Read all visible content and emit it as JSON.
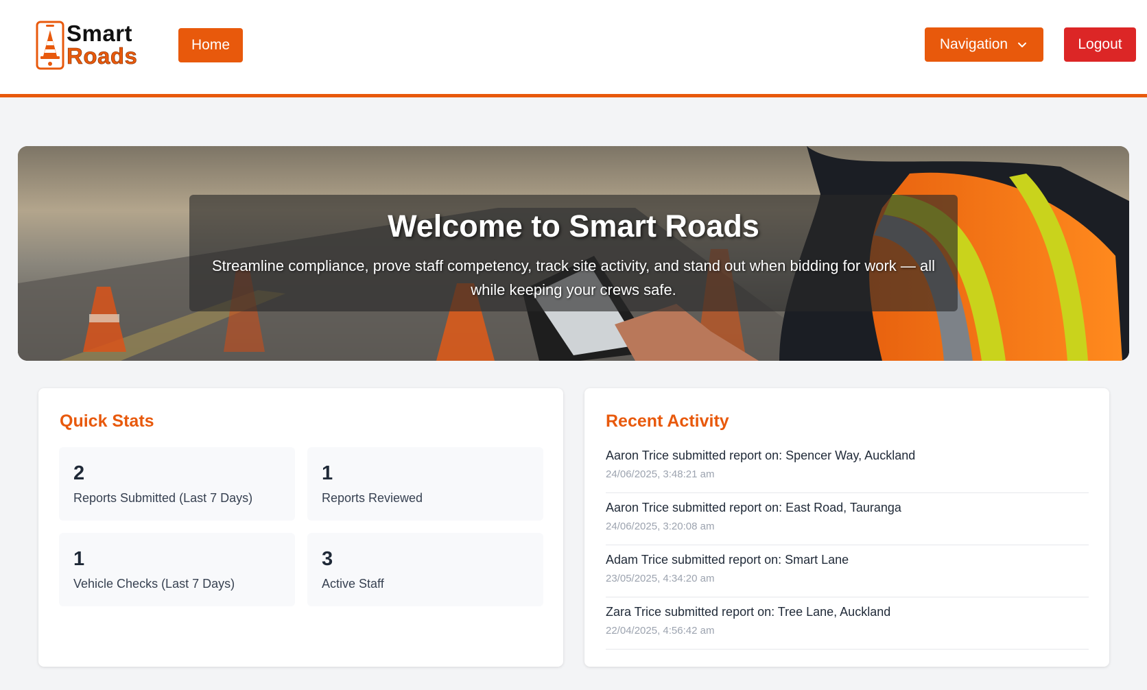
{
  "brand": {
    "line1": "Smart",
    "line2": "Roads",
    "primary_color": "#e8590c",
    "danger_color": "#dc2626"
  },
  "header": {
    "home_label": "Home",
    "nav_label": "Navigation",
    "nav_icon": "chevron-down-icon",
    "logout_label": "Logout"
  },
  "hero": {
    "title": "Welcome to Smart Roads",
    "subtitle": "Streamline compliance, prove staff competency, track site activity, and stand out when bidding for work — all while keeping your crews safe."
  },
  "stats": {
    "title": "Quick Stats",
    "items": [
      {
        "value": "2",
        "label": "Reports Submitted (Last 7 Days)"
      },
      {
        "value": "1",
        "label": "Reports Reviewed"
      },
      {
        "value": "1",
        "label": "Vehicle Checks (Last 7 Days)"
      },
      {
        "value": "3",
        "label": "Active Staff"
      }
    ]
  },
  "activity": {
    "title": "Recent Activity",
    "items": [
      {
        "text": "Aaron Trice submitted report on: Spencer Way, Auckland",
        "time": "24/06/2025, 3:48:21 am"
      },
      {
        "text": "Aaron Trice submitted report on: East Road, Tauranga",
        "time": "24/06/2025, 3:20:08 am"
      },
      {
        "text": "Adam Trice submitted report on: Smart Lane",
        "time": "23/05/2025, 4:34:20 am"
      },
      {
        "text": "Zara Trice submitted report on: Tree Lane, Auckland",
        "time": "22/04/2025, 4:56:42 am"
      }
    ]
  }
}
